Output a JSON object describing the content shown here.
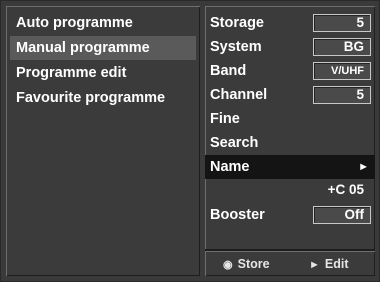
{
  "menu": {
    "items": [
      {
        "label": "Auto programme"
      },
      {
        "label": "Manual programme",
        "selected": true
      },
      {
        "label": "Programme edit"
      },
      {
        "label": "Favourite programme"
      }
    ]
  },
  "settings": {
    "storage": {
      "label": "Storage",
      "value": "5"
    },
    "system": {
      "label": "System",
      "value": "BG"
    },
    "band": {
      "label": "Band",
      "value": "V/UHF"
    },
    "channel": {
      "label": "Channel",
      "value": "5"
    },
    "fine": {
      "label": "Fine"
    },
    "search": {
      "label": "Search"
    },
    "name": {
      "label": "Name",
      "arrow": "►"
    },
    "name_value": "+C 05",
    "booster": {
      "label": "Booster",
      "value": "Off"
    }
  },
  "footer": {
    "store": {
      "icon": "◉",
      "icon_name": "circle-button-icon",
      "label": "Store"
    },
    "edit": {
      "icon": "►",
      "icon_name": "right-arrow-icon",
      "label": "Edit"
    }
  },
  "colors": {
    "panel_bg": "#3b3b3b",
    "selected_bg": "#5a5a5a",
    "highlight_bg": "#141414",
    "text": "#ffffff"
  }
}
